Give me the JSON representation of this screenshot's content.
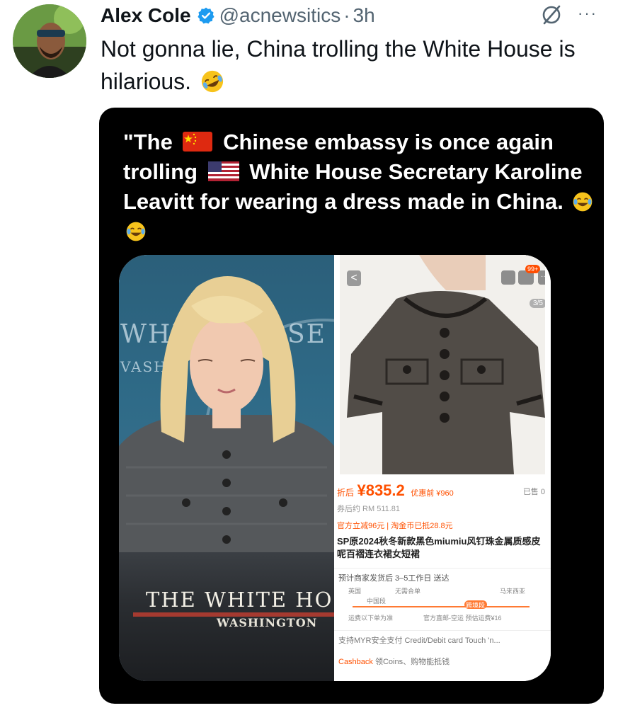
{
  "tweet": {
    "display_name": "Alex Cole",
    "handle": "@acnewsitics",
    "separator": "·",
    "time": "3h",
    "more_label": "···",
    "text": "Not gonna lie, China trolling the White House is hilarious.",
    "text_emoji": "rolling-on-floor-laughing-emoji",
    "icons": [
      "verified-badge-icon",
      "grok-icon",
      "more-icon"
    ]
  },
  "media": {
    "caption_parts": {
      "p1": "\"The",
      "p2": "Chinese embassy is once again trolling",
      "p3": "White House Secretary Karoline Leavitt for wearing a dress made in China."
    },
    "caption_flags": [
      "china-flag",
      "usa-flag"
    ],
    "caption_emoji": "face-with-tears-of-joy-emoji",
    "briefing": {
      "wall_left": "WHIT",
      "wall_right": "SE",
      "wall_small": "VASH",
      "podium_text": "THE WHITE HO",
      "podium_sub": "WASHINGTON"
    },
    "listing": {
      "back_label": "<",
      "cart_badge": "99+",
      "more_label": "···",
      "pager": "3/5",
      "price_tag": "折后",
      "price_main": "¥835.2",
      "price_orig": "优惠前 ¥960",
      "sold": "已售 0",
      "rm_line": "券后约 RM 511.81",
      "promo_line": "官方立减96元 | 淘金币已抵28.8元",
      "title_line": "SP原2024秋冬新款黑色miumiu风钉珠金属质感皮呢百褶连衣裙女短裙",
      "ship_line": "预计商家发货后 3–5工作日 送达",
      "route_from": "英国",
      "route_mid": "无需合单",
      "route_to": "马来西亚",
      "route_cn": "中国段",
      "route_pill": "跨境段",
      "route_note1": "运费以下单为准",
      "route_note2": "官方直邮-空运 预估运费¥16",
      "pay_line": "支持MYR安全支付   Credit/Debit card   Touch 'n...",
      "coin_cb": "Cashback",
      "coin_line": " 领Coins、购物能抵钱"
    }
  },
  "colors": {
    "text_primary": "#0f1419",
    "text_secondary": "#536471",
    "verified_blue": "#1d9bf0",
    "media_bg": "#000000",
    "price_orange": "#ff5000"
  }
}
